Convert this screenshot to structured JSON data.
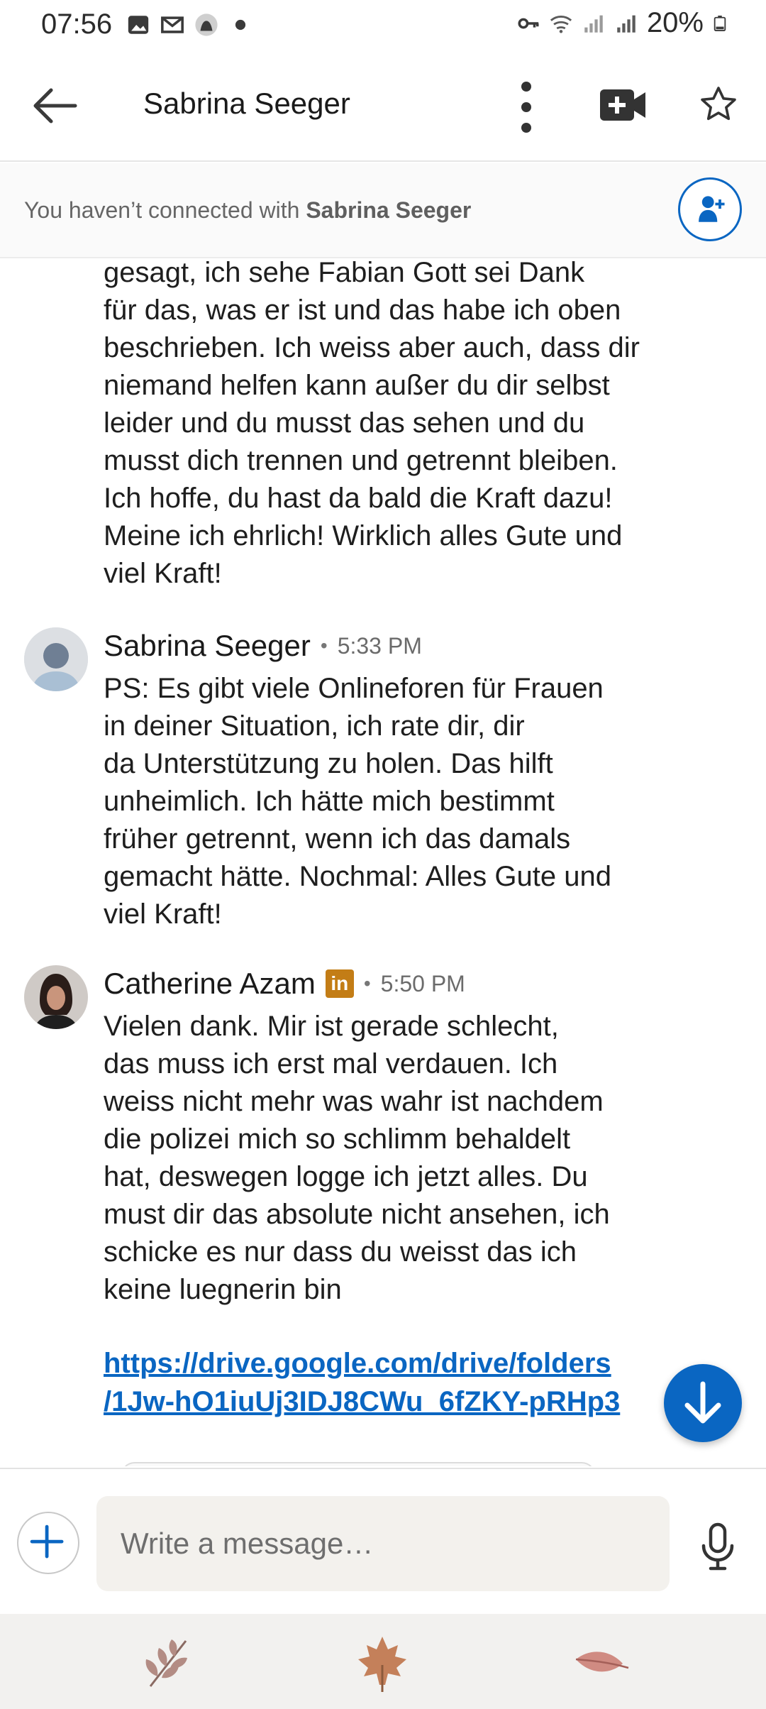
{
  "status_bar": {
    "time": "07:56",
    "battery": "20%"
  },
  "header": {
    "title": "Sabrina Seeger"
  },
  "connection_banner": {
    "prefix": "You haven’t connected with ",
    "name": "Sabrina Seeger"
  },
  "messages": {
    "continued_text_lines": [
      "gesagt, ich sehe Fabian Gott sei Dank",
      "für das, was er ist und das habe ich oben",
      "beschrieben. Ich weiss aber auch, dass dir",
      "niemand helfen kann außer du dir selbst",
      "leider und du musst das sehen und du",
      "musst dich trennen und getrennt bleiben.",
      "Ich hoffe, du hast da bald die Kraft dazu!",
      "Meine ich ehrlich! Wirklich alles Gute und",
      "viel Kraft!"
    ],
    "msg2": {
      "sender": "Sabrina Seeger",
      "separator": "•",
      "time": "5:33 PM",
      "lines": [
        "PS: Es gibt viele Onlineforen für Frauen",
        "in deiner Situation, ich rate dir, dir",
        "da Unterstützung zu holen. Das hilft",
        "unheimlich. Ich hätte mich bestimmt",
        "früher getrennt, wenn ich das damals",
        "gemacht hätte. Nochmal: Alles Gute und",
        "viel Kraft!"
      ]
    },
    "msg3": {
      "sender": "Catherine Azam",
      "badge": "in",
      "separator": "•",
      "time": "5:50 PM",
      "lines": [
        "Vielen dank. Mir ist gerade schlecht,",
        "das muss ich erst mal verdauen. Ich",
        "weiss nicht mehr was wahr ist nachdem",
        "die polizei mich so schlimm behaldelt",
        "hat, deswegen logge ich jetzt alles. Du",
        "must dir das absolute nicht ansehen, ich",
        "schicke es nur dass du weisst das ich",
        "keine luegnerin bin"
      ],
      "link_lines": [
        "https://drive.google.com/drive/folders",
        "/1Jw-hO1iuUj3IDJ8CWu_6fZKY-pRHp3"
      ]
    }
  },
  "composer": {
    "placeholder": "Write a message…"
  },
  "colors": {
    "brand_blue": "#0a66c2",
    "premium_badge": "#c37d16"
  },
  "icons": {
    "status_left": [
      "image-icon",
      "gmail-icon",
      "app-icon"
    ],
    "status_right": [
      "vpn-key-icon",
      "wifi-icon",
      "signal-icon",
      "battery-icon"
    ],
    "header": [
      "back-arrow-icon",
      "more-vertical-icon",
      "video-call-icon",
      "star-icon"
    ],
    "bottom_bar": [
      "leaf-icon",
      "maple-leaf-icon",
      "feather-leaf-icon"
    ]
  }
}
